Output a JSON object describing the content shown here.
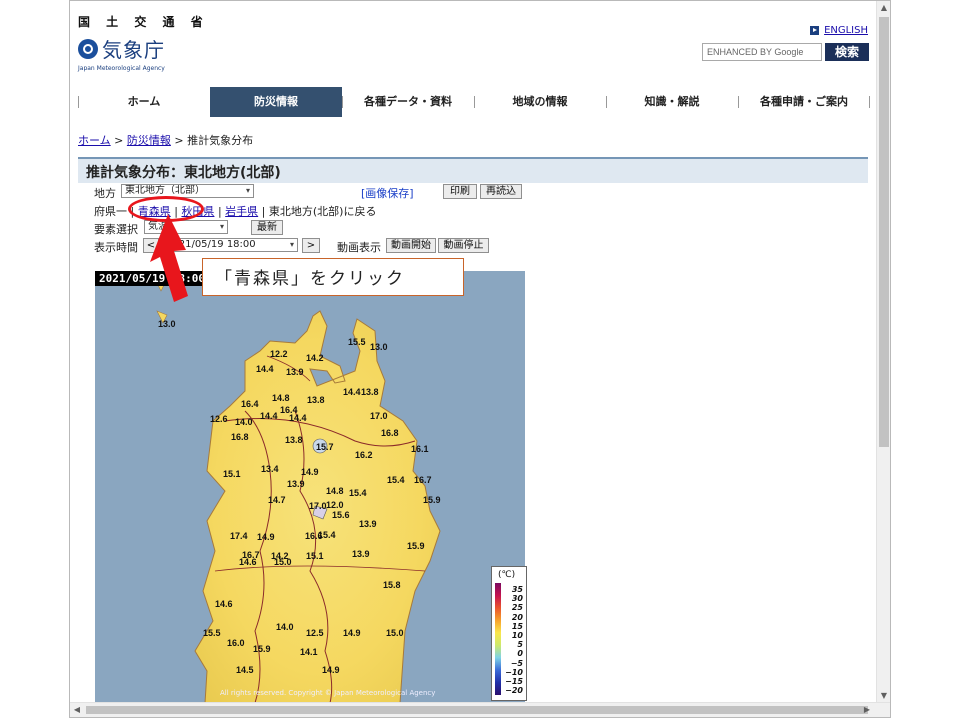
{
  "header": {
    "ministry": "国 土 交 通 省",
    "agency_name": "気象庁",
    "agency_en": "Japan Meteorological Agency",
    "english_link": "ENGLISH",
    "search_placeholder": "ENHANCED BY Google",
    "search_button": "検索"
  },
  "nav": {
    "tabs": [
      {
        "label": "ホーム"
      },
      {
        "label": "防災情報",
        "active": true
      },
      {
        "label": "各種データ・資料"
      },
      {
        "label": "地域の情報"
      },
      {
        "label": "知識・解説"
      },
      {
        "label": "各種申請・ご案内"
      }
    ]
  },
  "breadcrumb": {
    "home": "ホーム",
    "sep1": " > ",
    "disaster": "防災情報",
    "sep2": " > ",
    "current": "推計気象分布"
  },
  "page": {
    "title": "推計気象分布：東北地方(北部)"
  },
  "controls": {
    "region_label": "地方",
    "region_value": "東北地方（北部）",
    "save_image": "[画像保存]",
    "print": "印刷",
    "reload": "再読込",
    "pref_label": "府県一",
    "sep": "|",
    "pref_aomori": "青森県",
    "pref_akita": "秋田県",
    "pref_iwate": "岩手県",
    "back_to_region": "東北地方(北部)に戻る",
    "element_label": "要素選択",
    "element_value": "気温",
    "latest": "最新",
    "time_label": "表示時間",
    "prev": "<",
    "time_value": "2021/05/19 18:00",
    "next": ">",
    "animation_label": "動画表示",
    "animation_start": "動画開始",
    "animation_stop": "動画停止"
  },
  "map": {
    "timestamp": "2021/05/19 18:00",
    "copyright": "All rights reserved. Copyright © Japan Meteorological Agency",
    "temperatures": [
      "13.0",
      "15.5",
      "13.0",
      "12.2",
      "14.2",
      "14.4",
      "13.9",
      "14.6",
      "14.4",
      "13.8",
      "16.4",
      "14.8",
      "13.8",
      "16.4",
      "12.6",
      "14.4",
      "14.4",
      "17.0",
      "14.0",
      "16.8",
      "13.8",
      "15.7",
      "16.8",
      "16.2",
      "16.1",
      "15.1",
      "13.4",
      "14.9",
      "15.4",
      "16.7",
      "13.9",
      "14.8",
      "15.4",
      "15.9",
      "14.7",
      "12.0",
      "15.6",
      "17.0",
      "13.9",
      "15.4",
      "15.9",
      "17.4",
      "14.9",
      "16.6",
      "16.7",
      "14.2",
      "15.1",
      "13.9",
      "14.6",
      "15.0",
      "15.5",
      "14.0",
      "12.5",
      "14.9",
      "15.0",
      "16.0",
      "14.5",
      "15.9",
      "14.1",
      "14.9",
      "15.8"
    ],
    "legend_unit": "(℃)",
    "legend_values": [
      "35",
      "30",
      "25",
      "20",
      "15",
      "10",
      "5",
      "0",
      "−5",
      "−10",
      "−15",
      "−20"
    ]
  },
  "annotation": {
    "callout": "「青森県」をクリック"
  },
  "colors": {
    "nav_active": "#34506f",
    "title_bg": "#dfe8f1",
    "highlight": "#e8161c",
    "search_button": "#1b2f59"
  }
}
